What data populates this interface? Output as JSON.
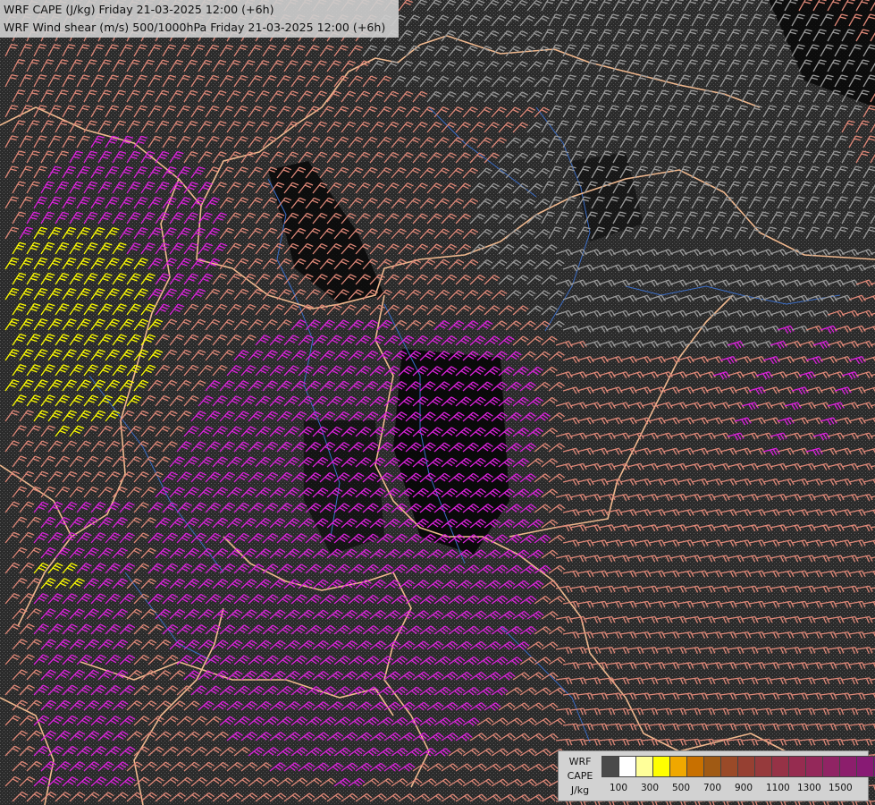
{
  "header": {
    "line1": "WRF CAPE (J/kg) Friday 21-03-2025 12:00 (+6h)",
    "line2": "WRF Wind shear (m/s) 500/1000hPa Friday 21-03-2025 12:00 (+6h)"
  },
  "legend": {
    "model_label": "WRF",
    "field_label": "CAPE",
    "unit_label": "J/kg",
    "colors": [
      "#4a4a4a",
      "#ffffff",
      "#ffff9a",
      "#ffff00",
      "#f0a800",
      "#c87000",
      "#a05a14",
      "#9a4a28",
      "#964032",
      "#963a3c",
      "#963246",
      "#962c50",
      "#94285a",
      "#902464",
      "#8c1e6c",
      "#881a74",
      "#84147a"
    ],
    "tick_labels": [
      "100",
      "300",
      "500",
      "700",
      "900",
      "1100",
      "1300",
      "1500"
    ]
  },
  "map_colors": {
    "border": "#f0b88e",
    "river": "#3c6ec8",
    "barb_low": "#e08878",
    "barb_gray": "#9a9a9a",
    "barb_magenta": "#dd22dd",
    "barb_yellow": "#ffff00"
  }
}
